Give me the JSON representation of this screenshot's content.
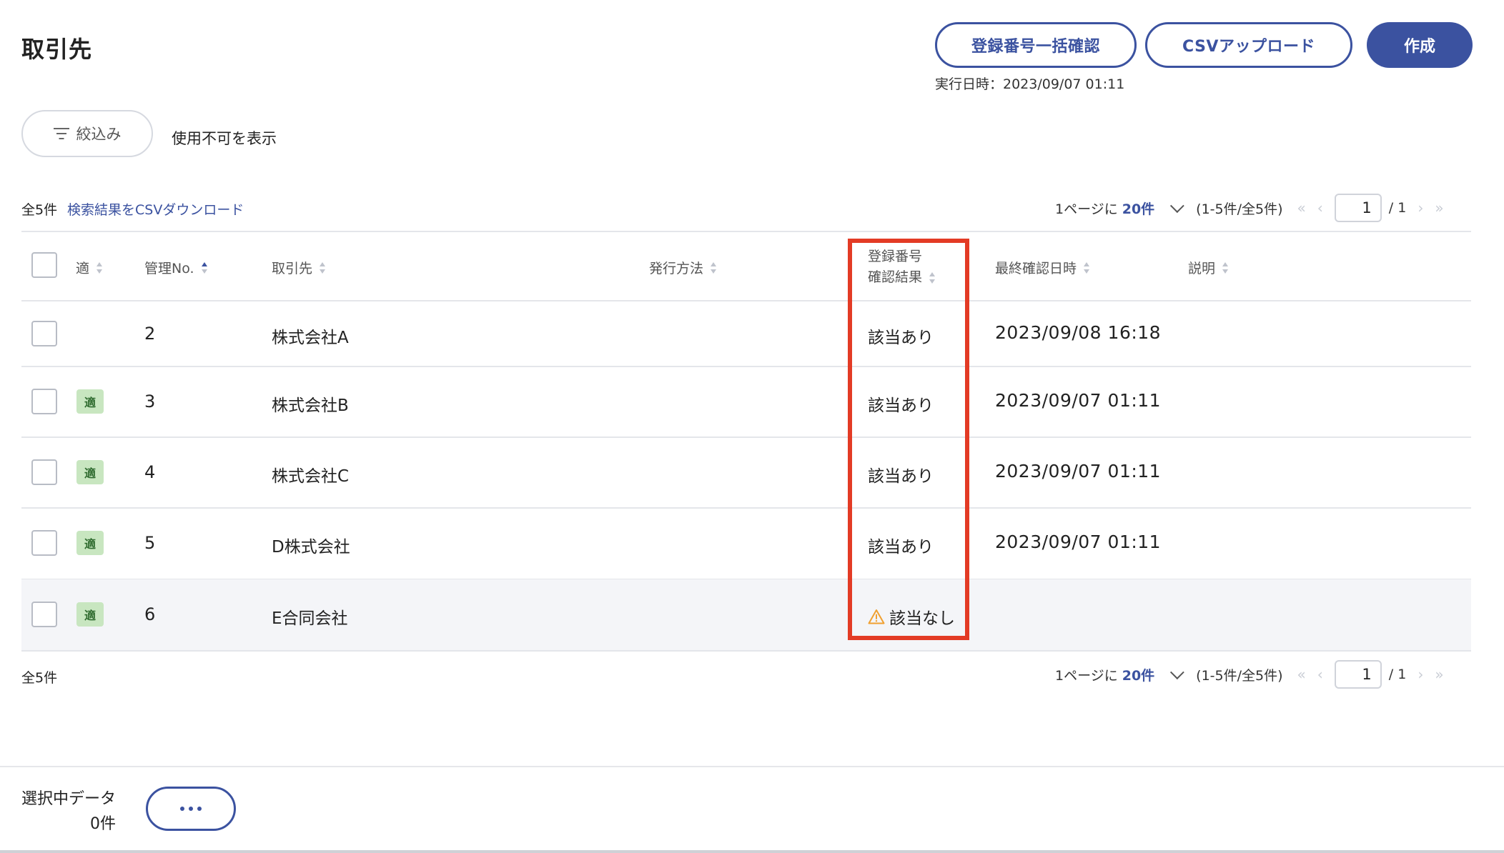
{
  "page": {
    "title": "取引先"
  },
  "toolbar": {
    "bulk_confirm_label": "登録番号一括確認",
    "csv_upload_label": "CSVアップロード",
    "create_label": "作成",
    "exec_time": "実行日時：2023/09/07 01:11"
  },
  "filter": {
    "label": "絞込み",
    "show_disabled_label": "使用不可を表示"
  },
  "summary": {
    "total_top": "全5件",
    "csv_download": "検索結果をCSVダウンロード",
    "total_bottom": "全5件"
  },
  "pagination": {
    "per_page_prefix": "1ページに",
    "per_page_value": "20件",
    "range": "(1-5件/全5件)",
    "current_page": "1",
    "total_pages": "/ 1"
  },
  "table": {
    "headers": {
      "fit": "適",
      "mgmt_no": "管理No.",
      "partner": "取引先",
      "issue_method": "発行方法",
      "reg_result_line1": "登録番号",
      "reg_result_line2": "確認結果",
      "last_checked": "最終確認日時",
      "description": "説明"
    },
    "rows": [
      {
        "badge": "",
        "no": "2",
        "partner": "株式会社A",
        "result": "該当あり",
        "last_checked": "2023/09/08 16:18",
        "warning": false
      },
      {
        "badge": "適",
        "no": "3",
        "partner": "株式会社B",
        "result": "該当あり",
        "last_checked": "2023/09/07 01:11",
        "warning": false
      },
      {
        "badge": "適",
        "no": "4",
        "partner": "株式会社C",
        "result": "該当あり",
        "last_checked": "2023/09/07 01:11",
        "warning": false
      },
      {
        "badge": "適",
        "no": "5",
        "partner": "D株式会社",
        "result": "該当あり",
        "last_checked": "2023/09/07 01:11",
        "warning": false
      },
      {
        "badge": "適",
        "no": "6",
        "partner": "E合同会社",
        "result": "該当なし",
        "last_checked": "",
        "warning": true
      }
    ]
  },
  "selection": {
    "label": "選択中データ",
    "count": "0件"
  },
  "icons": {
    "filter": "filter-icon",
    "sort": "sort-icon",
    "warning": "warning-icon",
    "more": "more-icon"
  },
  "colors": {
    "accent": "#3b52a0",
    "highlight": "#e33b25",
    "badge_bg": "#c8e6c0",
    "warning": "#f0a030"
  }
}
